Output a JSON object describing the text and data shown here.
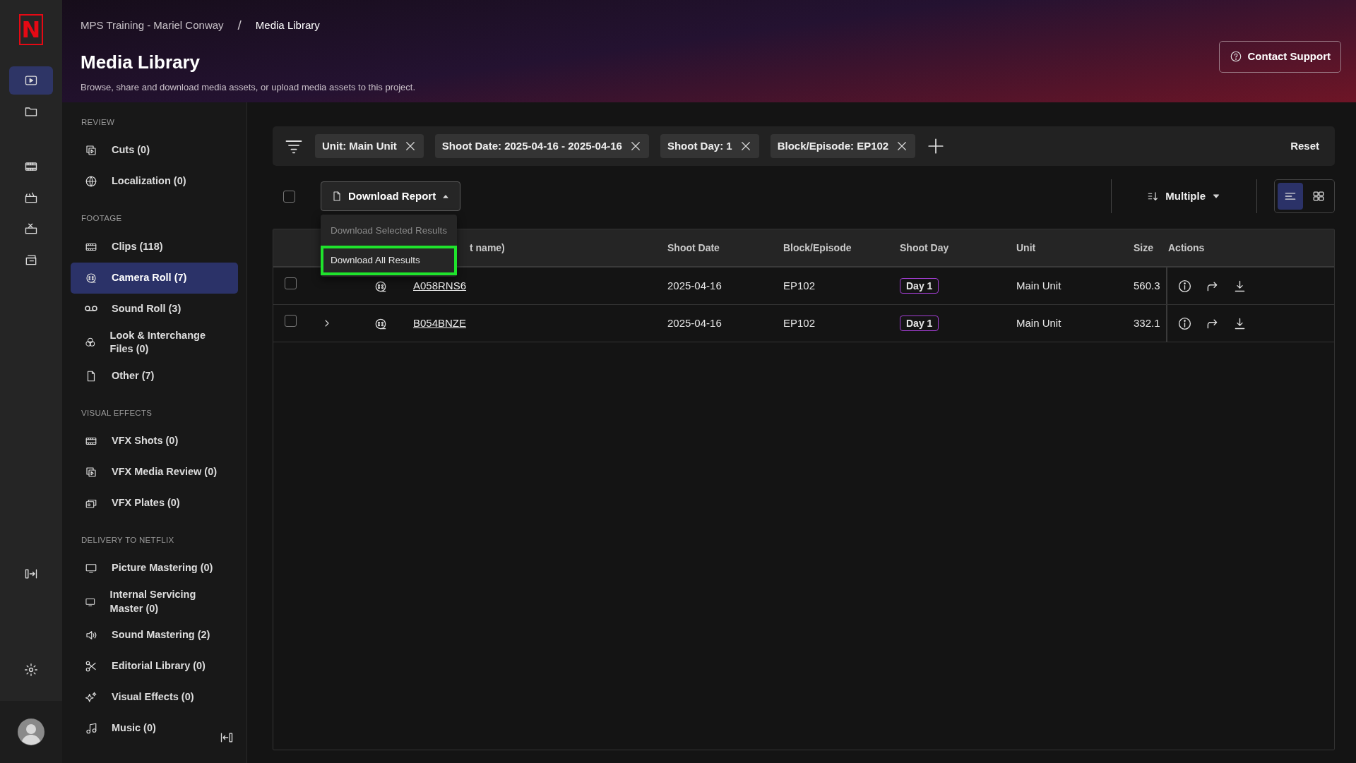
{
  "logo": "N",
  "rail": [
    {
      "selected": true
    },
    {
      "selected": false
    },
    {
      "selected": false
    },
    {
      "selected": false
    },
    {
      "selected": false
    },
    {
      "selected": false
    }
  ],
  "breadcrumb": [
    "MPS Training - Mariel Conway",
    "/",
    "Media Library"
  ],
  "page": {
    "title": "Media Library",
    "subtitle": "Browse, share and download media assets, or upload media assets to this project."
  },
  "contact_button": "Contact Support",
  "sidebar": [
    {
      "title": "REVIEW",
      "items": [
        {
          "label": "Cuts (0)",
          "selected": false
        },
        {
          "label": "Localization (0)",
          "selected": false
        }
      ]
    },
    {
      "title": "FOOTAGE",
      "items": [
        {
          "label": "Clips (118)",
          "selected": false
        },
        {
          "label": "Camera Roll (7)",
          "selected": true
        },
        {
          "label": "Sound Roll (3)",
          "selected": false
        },
        {
          "label": "Look & Interchange Files (0)",
          "selected": false
        },
        {
          "label": "Other (7)",
          "selected": false
        }
      ]
    },
    {
      "title": "VISUAL EFFECTS",
      "items": [
        {
          "label": "VFX Shots (0)",
          "selected": false
        },
        {
          "label": "VFX Media Review (0)",
          "selected": false
        },
        {
          "label": "VFX Plates (0)",
          "selected": false
        }
      ]
    },
    {
      "title": "DELIVERY TO NETFLIX",
      "items": [
        {
          "label": "Picture Mastering (0)",
          "selected": false
        },
        {
          "label": "Internal Servicing Master (0)",
          "selected": false
        },
        {
          "label": "Sound Mastering (2)",
          "selected": false
        },
        {
          "label": "Editorial Library (0)",
          "selected": false
        },
        {
          "label": "Visual Effects (0)",
          "selected": false
        },
        {
          "label": "Music (0)",
          "selected": false
        }
      ]
    }
  ],
  "filters": [
    "Unit: Main Unit",
    "Shoot Date: 2025-04-16 - 2025-04-16",
    "Shoot Day: 1",
    "Block/Episode: EP102"
  ],
  "reset_button": "Reset",
  "select_all": {
    "checked": false
  },
  "download_report": {
    "label": "Download Report",
    "expanded": true,
    "menu": [
      {
        "label": "Download Selected Results",
        "disabled": true,
        "highlighted": false
      },
      {
        "label": "Download All Results",
        "disabled": false,
        "highlighted": true
      }
    ]
  },
  "sort": {
    "label": "Multiple"
  },
  "view_toggle": [
    {
      "selected": true
    },
    {
      "selected": false
    }
  ],
  "table": {
    "columns": [
      "t name)",
      "Shoot Date",
      "Block/Episode",
      "Shoot Day",
      "Unit",
      "Size",
      "Actions"
    ],
    "rows": [
      {
        "checked": false,
        "name": "A058RNS6",
        "shoot_date": "2025-04-16",
        "block": "EP102",
        "shoot_day": "Day 1",
        "unit": "Main Unit",
        "size": "560.3"
      },
      {
        "checked": false,
        "expanded": false,
        "name": "B054BNZE",
        "shoot_date": "2025-04-16",
        "block": "EP102",
        "shoot_day": "Day 1",
        "unit": "Main Unit",
        "size": "332.1"
      }
    ]
  }
}
